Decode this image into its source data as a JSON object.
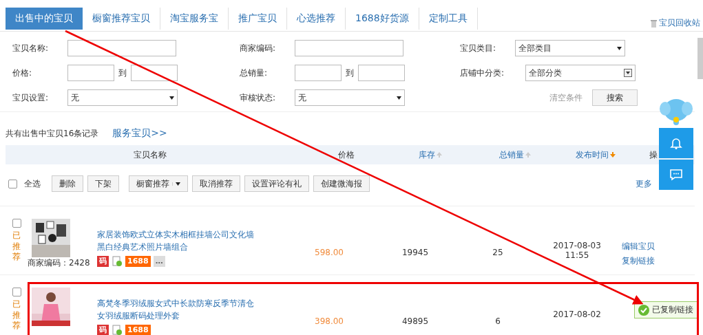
{
  "tabs": [
    {
      "label": "出售中的宝贝",
      "selected": true
    },
    {
      "label": "橱窗推荐宝贝",
      "selected": false
    },
    {
      "label": "淘宝服务宝",
      "selected": false
    },
    {
      "label": "推广宝贝",
      "selected": false
    },
    {
      "label": "心选推荐",
      "selected": false
    },
    {
      "label": "1688好货源",
      "selected": false
    },
    {
      "label": "定制工具",
      "selected": false
    }
  ],
  "recycle_bin": "宝贝回收站",
  "filters": [
    [
      {
        "label": "宝贝名称:",
        "kind": "text"
      },
      {
        "label": "商家编码:",
        "kind": "text"
      },
      {
        "label": "宝贝类目:",
        "kind": "select",
        "value": "全部类目"
      }
    ],
    [
      {
        "label": "价格:",
        "kind": "range",
        "to": "到"
      },
      {
        "label": "总销量:",
        "kind": "range",
        "to": "到"
      },
      {
        "label": "店铺中分类:",
        "kind": "combo",
        "value": "全部分类"
      }
    ],
    [
      {
        "label": "宝贝设置:",
        "kind": "select",
        "value": "无"
      },
      {
        "label": "审核状态:",
        "kind": "select",
        "value": "无"
      },
      {
        "kind": "actions",
        "clear": "清空条件",
        "search": "搜索"
      }
    ]
  ],
  "summary": "共有出售中宝贝16条记录",
  "service_link": "服务宝贝>>",
  "columns": [
    {
      "label": "宝贝名称",
      "sortable": false,
      "sorted": false
    },
    {
      "label": "价格",
      "sortable": false,
      "sorted": false
    },
    {
      "label": "库存",
      "sortable": true,
      "sorted": false
    },
    {
      "label": "总销量",
      "sortable": true,
      "sorted": false
    },
    {
      "label": "发布时间",
      "sortable": true,
      "sorted": true
    },
    {
      "label": "操",
      "sortable": false,
      "sorted": false
    }
  ],
  "toolbar": {
    "select_all": {
      "label": "全选",
      "checked": false
    },
    "buttons": [
      {
        "label": "删除",
        "kind": "plain"
      },
      {
        "label": "下架",
        "kind": "plain"
      },
      {
        "label": "橱窗推荐",
        "kind": "split"
      },
      {
        "label": "取消推荐",
        "kind": "plain"
      },
      {
        "label": "设置评论有礼",
        "kind": "plain"
      },
      {
        "label": "创建微海报",
        "kind": "plain"
      }
    ],
    "more": "更多"
  },
  "rows": [
    {
      "checked": false,
      "status": "已推荐",
      "title": "家居装饰欧式立体实木相框挂墙公司文化墙黑白经典艺术照片墙组合",
      "tags": [
        "码",
        "1688",
        "…"
      ],
      "merchant_code": "商家编码：2428",
      "price": "598.00",
      "stock": "19945",
      "sales": "25",
      "date": "2017-08-03",
      "time": "11:55",
      "actions": [
        "编辑宝贝",
        "复制链接"
      ],
      "highlighted": false
    },
    {
      "checked": false,
      "status": "已推荐",
      "title": "高梵冬季羽绒服女式中长款防寒反季节清仓女羽绒服断码处理外套",
      "tags": [
        "码",
        "1688"
      ],
      "price": "398.00",
      "stock": "49895",
      "sales": "6",
      "date": "2017-08-02",
      "toast": "已复制链接",
      "highlighted": true
    }
  ]
}
